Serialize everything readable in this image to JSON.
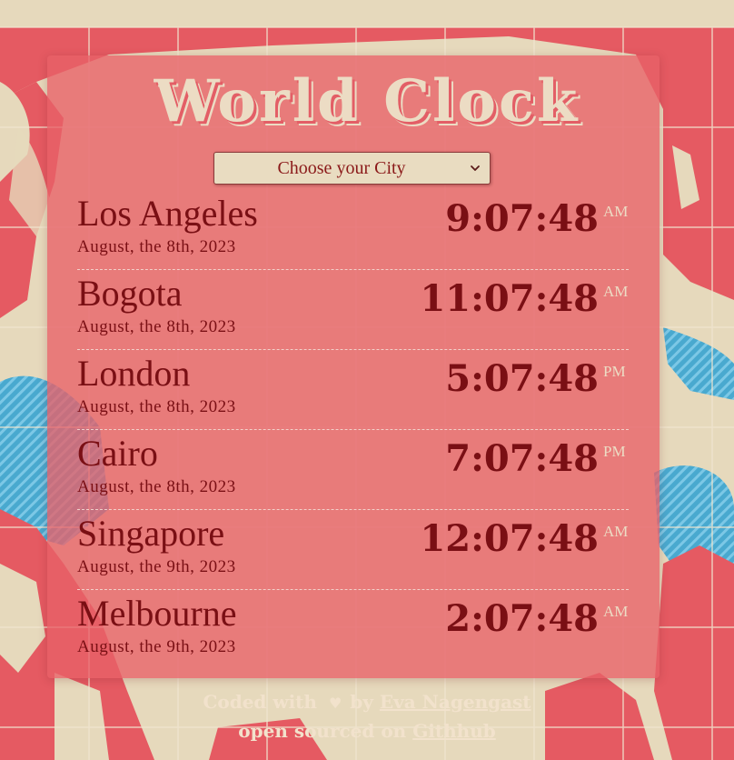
{
  "title": "World Clock",
  "select": {
    "selected": "Choose your City",
    "chevron_icon": "chevron-down-icon"
  },
  "cities": [
    {
      "name": "Los Angeles",
      "date": "August, the 8th, 2023",
      "time": "9:07:48",
      "ampm": "AM"
    },
    {
      "name": "Bogota",
      "date": "August, the 8th, 2023",
      "time": "11:07:48",
      "ampm": "AM"
    },
    {
      "name": "London",
      "date": "August, the 8th, 2023",
      "time": "5:07:48",
      "ampm": "PM"
    },
    {
      "name": "Cairo",
      "date": "August, the 8th, 2023",
      "time": "7:07:48",
      "ampm": "PM"
    },
    {
      "name": "Singapore",
      "date": "August, the 9th, 2023",
      "time": "12:07:48",
      "ampm": "AM"
    },
    {
      "name": "Melbourne",
      "date": "August, the 9th, 2023",
      "time": "2:07:48",
      "ampm": "AM"
    }
  ],
  "footer": {
    "coded_with": "Coded with",
    "heart_icon": "heart-icon",
    "heart_glyph": "♥",
    "by": "by",
    "author": "Eva Nagengast",
    "open_sourced_on": "open sourced on",
    "github": "Githhub"
  },
  "colors": {
    "panel": "#e86068",
    "text_dark": "#7a0f14",
    "cream": "#ecdcc4",
    "sea": "#4fb3d9"
  }
}
